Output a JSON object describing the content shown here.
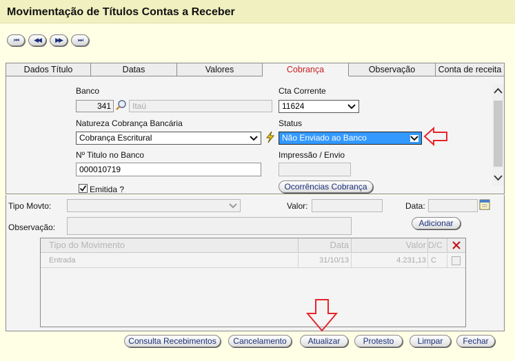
{
  "window": {
    "title": "Movimentação de Títulos Contas a Receber"
  },
  "nav": {
    "first": "first-record",
    "prev": "previous-record",
    "next": "next-record",
    "last": "last-record"
  },
  "tabs": [
    {
      "label": "Dados Título"
    },
    {
      "label": "Datas"
    },
    {
      "label": "Valores"
    },
    {
      "label": "Cobrança"
    },
    {
      "label": "Observação"
    },
    {
      "label": "Conta de receita"
    }
  ],
  "cobranca": {
    "banco_label": "Banco",
    "banco_code": "341",
    "banco_name": "Itaú",
    "cta_label": "Cta Corrente",
    "cta_value": "11624",
    "natureza_label": "Natureza Cobrança Bancária",
    "natureza_value": "Cobrança Escritural",
    "status_label": "Status",
    "status_value": "Não Enviado ao Banco",
    "titulo_label": "Nº Titulo no Banco",
    "titulo_value": "000010719",
    "impressao_label": "Impressão / Envio",
    "impressao_value": "",
    "emitida_label": "Emitida ?",
    "emitida_checked": true,
    "ocorrencias_button": "Ocorrências Cobrança"
  },
  "movimento": {
    "tipo_label": "Tipo Movto:",
    "tipo_value": "",
    "valor_label": "Valor:",
    "valor_value": "",
    "data_label": "Data:",
    "data_value": "",
    "obs_label": "Observação:",
    "obs_value": "",
    "adicionar_button": "Adicionar"
  },
  "grid": {
    "headers": [
      "Tipo do Movimento",
      "Data",
      "Valor",
      "D/C"
    ],
    "rows": [
      {
        "tipo": "Entrada",
        "data": "31/10/13",
        "valor": "4.231,13",
        "dc": "C"
      }
    ]
  },
  "footer": {
    "consulta": "Consulta Recebimentos",
    "cancelamento": "Cancelamento",
    "atualizar": "Atualizar",
    "protesto": "Protesto",
    "limpar": "Limpar",
    "fechar": "Fechar"
  },
  "colors": {
    "annotation_arrow": "#E8232A",
    "status_highlight": "#3399FF",
    "active_tab": "#C62020"
  }
}
